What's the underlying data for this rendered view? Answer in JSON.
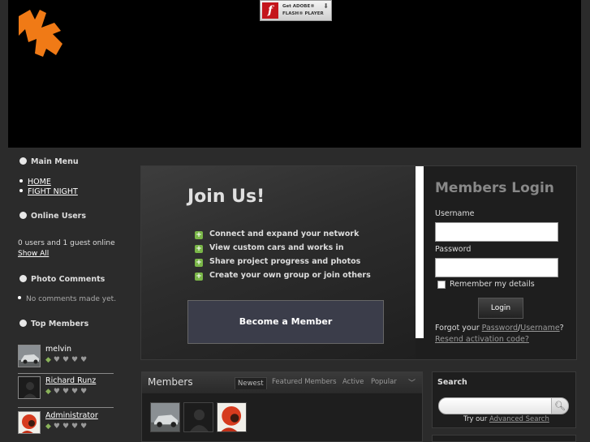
{
  "flash": {
    "line1": "Get ADOBE®",
    "line2": "FLASH® PLAYER",
    "logo": "f"
  },
  "sidebar": {
    "main_menu": "Main Menu",
    "links": [
      {
        "label": "HOME"
      },
      {
        "label": "FIGHT NIGHT"
      }
    ],
    "online_users": "Online Users",
    "online_text": "0 users and 1 guest online",
    "show_all": "Show All",
    "photo_comments": "Photo Comments",
    "no_comments": "No comments made yet.",
    "top_members": "Top Members",
    "members": [
      {
        "name": "melvin",
        "avatar": "car-photo"
      },
      {
        "name": "Richard Runz",
        "avatar": "default-user-silhouette"
      },
      {
        "name": "Administrator",
        "avatar": "portrait-photo"
      }
    ]
  },
  "join": {
    "title": "Join Us!",
    "features": [
      "Connect and expand your network",
      "View custom cars and works in",
      "Share project progress and photos",
      "Create your own group or join others"
    ],
    "become_button": "Become a Member"
  },
  "login": {
    "title": "Members Login",
    "username_label": "Username",
    "username_value": "",
    "password_label": "Password",
    "password_value": "",
    "remember_label": "Remember my details",
    "remember_checked": false,
    "button": "Login",
    "forgot_prefix": "Forgot your",
    "forgot_password": "Password",
    "forgot_sep": "/",
    "forgot_username": "Username",
    "forgot_suffix": "?",
    "resend": "Resend activation code?"
  },
  "members_box": {
    "title": "Members",
    "tabs": [
      "Newest",
      "Featured Members",
      "Active",
      "Popular"
    ],
    "active_tab": "Newest",
    "thumbs": [
      "car-photo",
      "default-user-silhouette",
      "portrait-photo"
    ]
  },
  "search": {
    "title": "Search",
    "query": "",
    "try_prefix": "Try our",
    "advanced_link": "Advanced Search"
  },
  "colors": {
    "accent_orange": "#f07a16",
    "rank_green": "#7ab648",
    "page_bg": "#2b2b2b"
  }
}
